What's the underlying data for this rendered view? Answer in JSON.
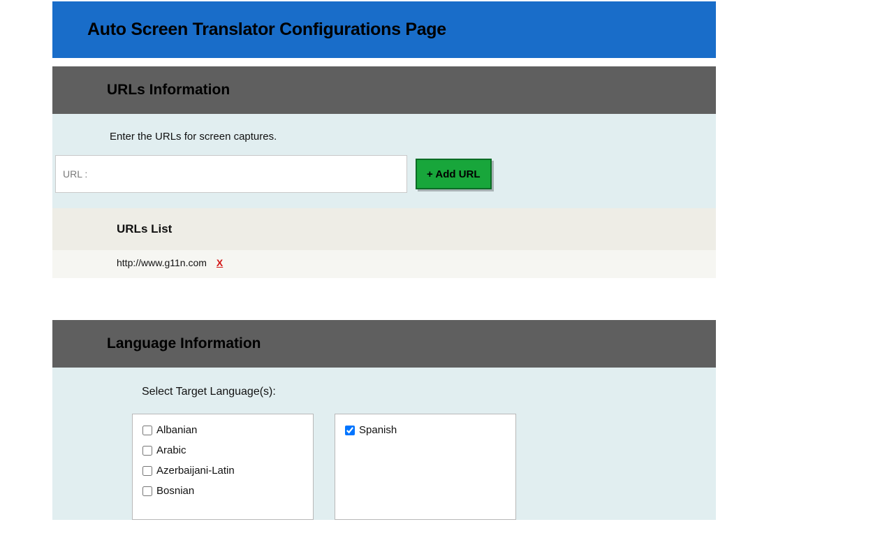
{
  "banner": {
    "title": "Auto Screen Translator Configurations Page"
  },
  "urls_section": {
    "header": "URLs Information",
    "instruction": "Enter the URLs for screen captures.",
    "url_prefix_label": "URL :",
    "url_input_value": "",
    "add_button_label": "+ Add URL",
    "list_header": "URLs List",
    "list": [
      {
        "url": "http://www.g11n.com",
        "delete_label": "X"
      }
    ]
  },
  "lang_section": {
    "header": "Language Information",
    "instruction": "Select Target Language(s):",
    "available": [
      "Albanian",
      "Arabic",
      "Azerbaijani-Latin",
      "Bosnian"
    ],
    "selected": [
      "Spanish"
    ]
  }
}
